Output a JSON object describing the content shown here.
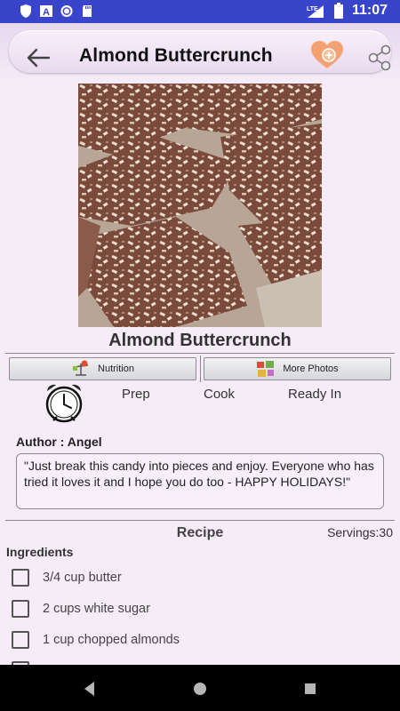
{
  "status_bar": {
    "time": "11:07",
    "network": "LTE",
    "icons": [
      "shield-icon",
      "a-icon",
      "sync-circle-icon",
      "sd-card-icon",
      "signal-icon",
      "battery-icon"
    ]
  },
  "app_bar": {
    "title": "Almond Buttercrunch",
    "back_icon": "arrow-left-icon",
    "favorite_icon": "heart-add-icon",
    "share_icon": "share-icon"
  },
  "recipe": {
    "title": "Almond Buttercrunch",
    "image": "almond-buttercrunch-photo"
  },
  "tabs": {
    "nutrition_label": "Nutrition",
    "more_photos_label": "More Photos"
  },
  "times": {
    "prep_label": "Prep",
    "cook_label": "Cook",
    "ready_label": "Ready In"
  },
  "author": {
    "label": "Author : Angel",
    "quote": "\"Just break this candy into pieces and enjoy. Everyone who has tried it loves it and I hope you do too - HAPPY HOLIDAYS!\""
  },
  "recipe_section": {
    "heading": "Recipe",
    "servings": "Servings:30",
    "ingredients_heading": "Ingredients",
    "ingredients": [
      "3/4 cup butter",
      "2 cups white sugar",
      "1 cup chopped almonds"
    ]
  },
  "colors": {
    "status_bar": "#3844c9",
    "background": "#f6ecf8",
    "favorite_accent": "#f29a6a"
  }
}
